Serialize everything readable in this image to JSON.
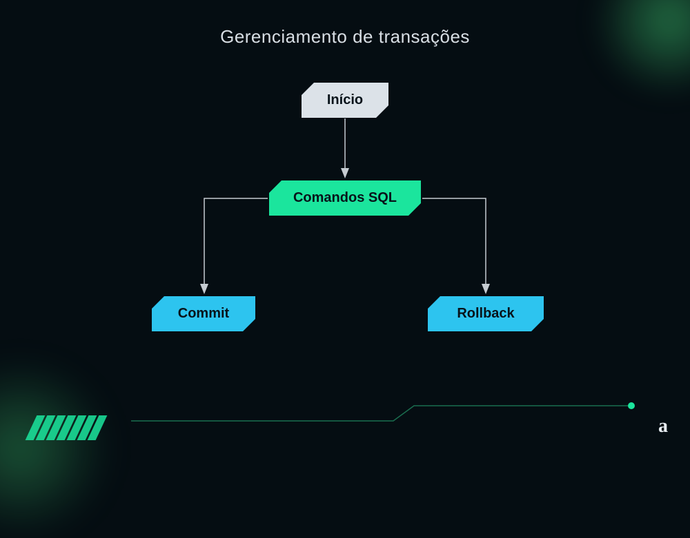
{
  "title": "Gerenciamento de transações",
  "nodes": {
    "inicio": "Início",
    "comandos": "Comandos SQL",
    "commit": "Commit",
    "rollback": "Rollback"
  },
  "logo": "a",
  "colors": {
    "background": "#050d12",
    "accent_green": "#1be59d",
    "accent_cyan": "#2dc4ef",
    "node_light": "#dce2e8",
    "text_light": "#d8dee4"
  }
}
